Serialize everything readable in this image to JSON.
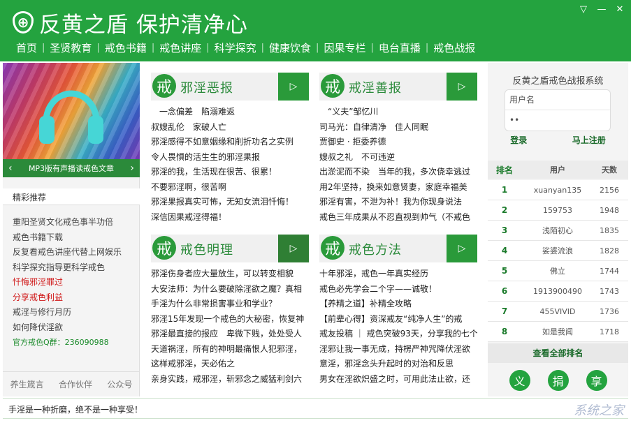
{
  "header": {
    "logo_glyph": "⊕",
    "title": "反黄之盾 保护清净心",
    "window_controls": {
      "menu": "▽",
      "minimize": "—",
      "close": "✕"
    },
    "nav": [
      "首页",
      "圣贤教育",
      "戒色书籍",
      "戒色讲座",
      "科学探究",
      "健康饮食",
      "因果专栏",
      "电台直播",
      "戒色战报"
    ]
  },
  "left": {
    "banner_caption": "MP3版有声播读戒色文章",
    "prev_arrow": "‹",
    "next_arrow": "›",
    "section_title": "精彩推荐",
    "recommended": [
      {
        "text": "重阳圣贤文化戒色事半功倍",
        "style": "normal"
      },
      {
        "text": "戒色书籍下载",
        "style": "normal"
      },
      {
        "text": "反复看戒色讲座代替上网娱乐",
        "style": "normal"
      },
      {
        "text": "科学探究指导更科学戒色",
        "style": "normal"
      },
      {
        "text": "忏悔邪淫罪过",
        "style": "red"
      },
      {
        "text": "分享戒色利益",
        "style": "red"
      },
      {
        "text": "戒淫与修行月历",
        "style": "normal"
      },
      {
        "text": "如何降伏淫欲",
        "style": "normal"
      },
      {
        "text": "官方戒色Q群：236090988",
        "style": "green"
      }
    ],
    "footer": [
      "养生箴言",
      "合作伙伴",
      "公众号"
    ]
  },
  "panels": [
    {
      "badge": "戒",
      "title": "邪淫恶报",
      "play": "▷",
      "lines": [
        "　一念偏差　陷溺难返",
        "叔嫂乱伦　家破人亡",
        "邪淫感得不如意姻缘和削折功名之实例",
        "令人畏惧的活生生的邪淫果报",
        "邪淫的我，生活现在很苦、很累！",
        "不要邪淫啊，很苦啊",
        "邪淫果报真实可怖，无知女流泪忏悔！",
        "深信因果戒淫得福！"
      ]
    },
    {
      "badge": "戒",
      "title": "戒淫善报",
      "play": "▷",
      "lines": [
        "　“义夫”邹忆川",
        "司马光：自律清净　佳人同眠",
        "贾御史 · 拒委养德",
        "嫂叔之礼　不可违逆",
        "出淤泥而不染　当年的我，多次侥幸逃过",
        "用2年坚持，换来如意贤妻，家庭幸福美",
        "邪淫有害，不泄为补！我为你现身说法",
        "戒色三年成果从不忍直视到帅气（不戒色"
      ]
    },
    {
      "badge": "戒",
      "title": "戒色明理",
      "play": "▷",
      "lines": [
        "邪淫伤身者应大量放生，可以转变相貌",
        "大安法师：为什么要破除淫欲之魔？真相",
        "手淫为什么非常损害事业和学业？",
        "邪淫15年发现一个戒色的大秘密，恢复神",
        "邪淫最直接的报应　卑微下贱，处处受人",
        "天道祸淫，所有的神明最痛恨人犯邪淫，",
        "这样戒邪淫，天必佑之",
        "亲身实践，戒邪淫，斩邪念之威猛利剑六"
      ]
    },
    {
      "badge": "戒",
      "title": "戒色方法",
      "play": "▷",
      "lines": [
        "十年邪淫，戒色一年真实经历",
        "戒色必先学会二个字——诚敬！",
        "【养精之道】补精全攻略",
        "【前辈心得】资深戒友“纯净人生”的戒",
        "戒友投稿 ｜ 戒色突破93天，分享我的七个",
        "淫邪让我一事无成，持楞严神咒降伏淫欲",
        "意淫，邪淫念头升起时的对治和反思",
        "男女在淫欲炽盛之时，可用此法止欲，还"
      ]
    }
  ],
  "right": {
    "login_title": "反黄之盾戒色战报系统",
    "username_placeholder": "用户名",
    "password_mask": "••",
    "login_label": "登录",
    "register_label": "马上注册",
    "rank_headers": [
      "排名",
      "用户",
      "天数"
    ],
    "ranking": [
      {
        "rank": "1",
        "user": "xuanyan135",
        "days": "2156"
      },
      {
        "rank": "2",
        "user": "159753",
        "days": "1948"
      },
      {
        "rank": "3",
        "user": "浅陌初心",
        "days": "1835"
      },
      {
        "rank": "4",
        "user": "娑婆流浪",
        "days": "1828"
      },
      {
        "rank": "5",
        "user": "佛立",
        "days": "1744"
      },
      {
        "rank": "6",
        "user": "1913900490",
        "days": "1743"
      },
      {
        "rank": "7",
        "user": "455VIVID",
        "days": "1736"
      },
      {
        "rank": "8",
        "user": "如是我闻",
        "days": "1718"
      }
    ],
    "rank_more": "查看全部排名",
    "round_buttons": [
      "义",
      "捐",
      "享"
    ]
  },
  "status": {
    "text": "手淫是一种折磨，绝不是一种享受！",
    "watermark": "系统之家"
  },
  "colors": {
    "brand_green": "#24a33f",
    "dark_green": "#2f7f34",
    "accent_red": "#d01818"
  }
}
